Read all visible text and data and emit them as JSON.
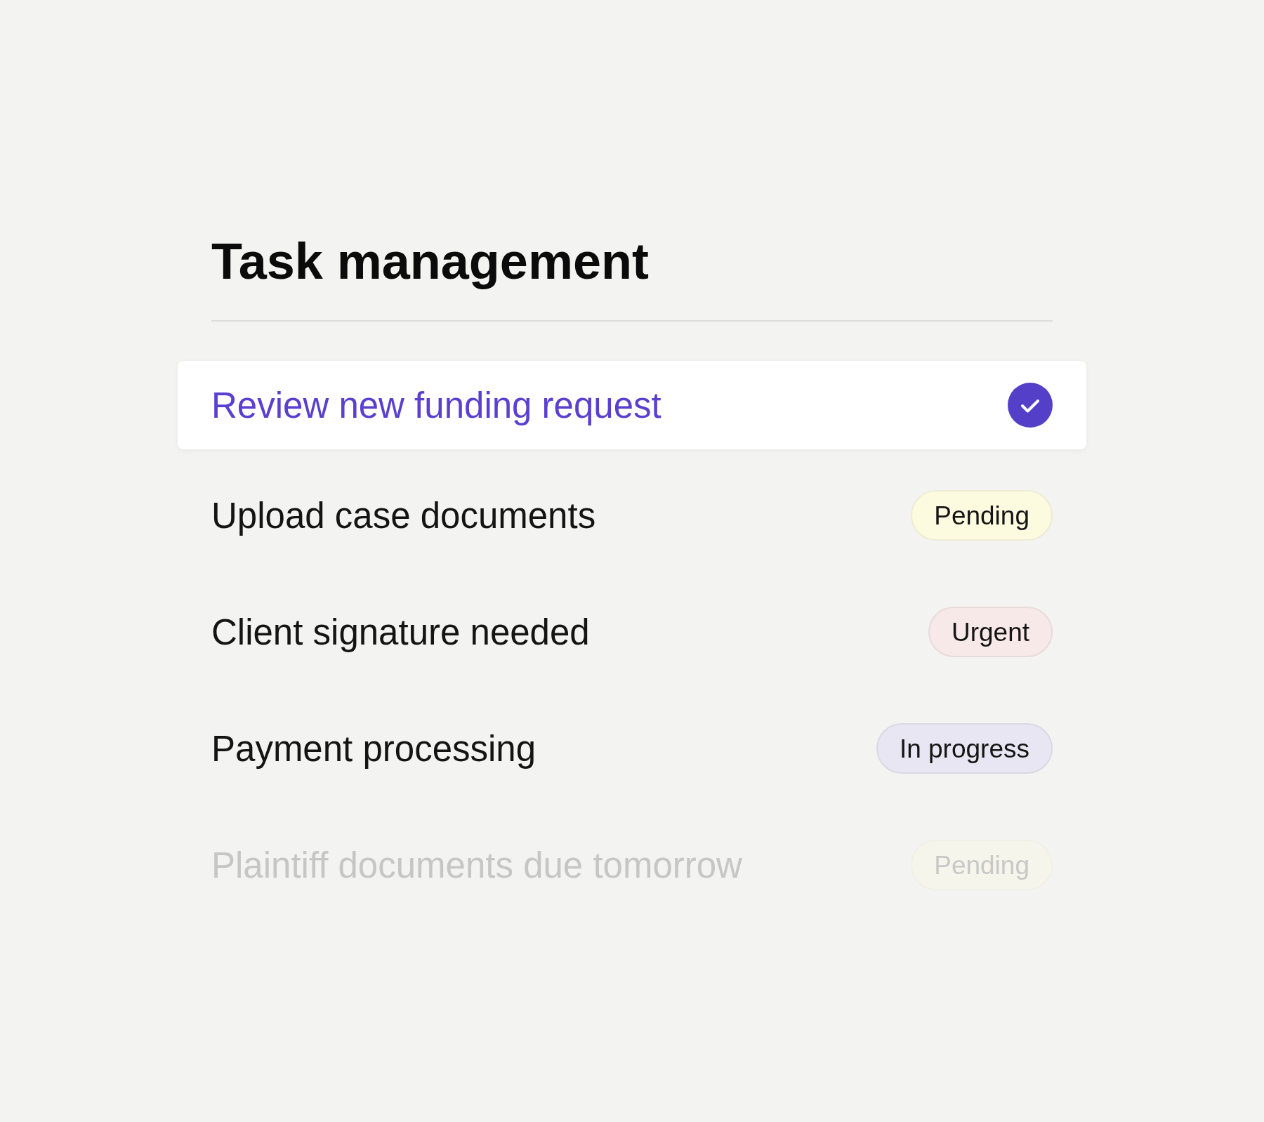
{
  "title": "Task management",
  "rows": [
    {
      "title": "Review new funding request",
      "selected": true,
      "faded": false
    },
    {
      "title": "Upload case documents",
      "selected": false,
      "faded": false,
      "tag": {
        "label": "Pending",
        "color": "#fcfbe0"
      }
    },
    {
      "title": "Client signature needed",
      "selected": false,
      "faded": false,
      "tag": {
        "label": "Urgent",
        "color": "#f6e9e8"
      }
    },
    {
      "title": "Payment processing",
      "selected": false,
      "faded": false,
      "tag": {
        "label": "In progress",
        "color": "#e9e6f3"
      }
    },
    {
      "title": "Plaintiff documents due tomorrow",
      "selected": false,
      "faded": true,
      "tag": {
        "label": "Pending",
        "color": "#f5f5ec"
      }
    }
  ]
}
